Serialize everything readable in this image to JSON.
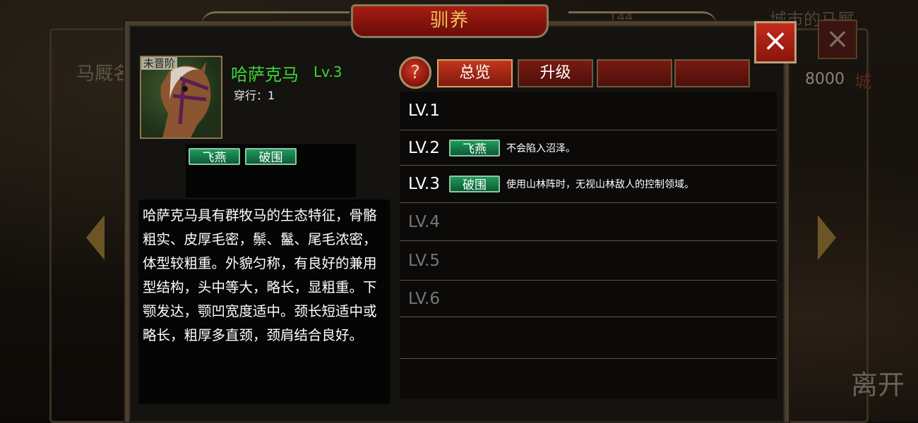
{
  "background": {
    "left_title": "马厩名",
    "top_middle": "144",
    "top_right": "城市的马厩",
    "currency": "8000",
    "right_label": "城",
    "leave_button": "离开",
    "close_icon": "×"
  },
  "panel": {
    "title": "驯养",
    "close_icon": "×"
  },
  "horse": {
    "stage": "未晋阶",
    "name": "哈萨克马",
    "level": "Lv.3",
    "rank_label": "穿行：",
    "rank_value": "1",
    "skills": [
      "飞燕",
      "破围"
    ],
    "description": "哈萨克马具有群牧马的生态特征，骨骼粗实、皮厚毛密，鬃、鬣、尾毛浓密，体型较粗重。外貌匀称，有良好的兼用型结构，头中等大，略长，显粗重。下颚发达，颚凹宽度适中。颈长短适中或略长，粗厚多直颈，颈肩结合良好。"
  },
  "help_icon": "?",
  "tabs": [
    {
      "label": "总览"
    },
    {
      "label": "升级"
    },
    {
      "label": ""
    },
    {
      "label": ""
    }
  ],
  "levels": [
    {
      "label": "LV.1",
      "skill": "",
      "desc": ""
    },
    {
      "label": "LV.2",
      "skill": "飞燕",
      "desc": "不会陷入沼泽。"
    },
    {
      "label": "LV.3",
      "skill": "破围",
      "desc": "使用山林阵时，无视山林敌人的控制领域。"
    },
    {
      "label": "LV.4",
      "skill": "",
      "desc": ""
    },
    {
      "label": "LV.5",
      "skill": "",
      "desc": ""
    },
    {
      "label": "LV.6",
      "skill": "",
      "desc": ""
    }
  ],
  "colors": {
    "name_green": "#3bd63a",
    "skill_green": "#1e9b5c",
    "active_tab": "#c2371e",
    "locked_level": "#777777"
  }
}
